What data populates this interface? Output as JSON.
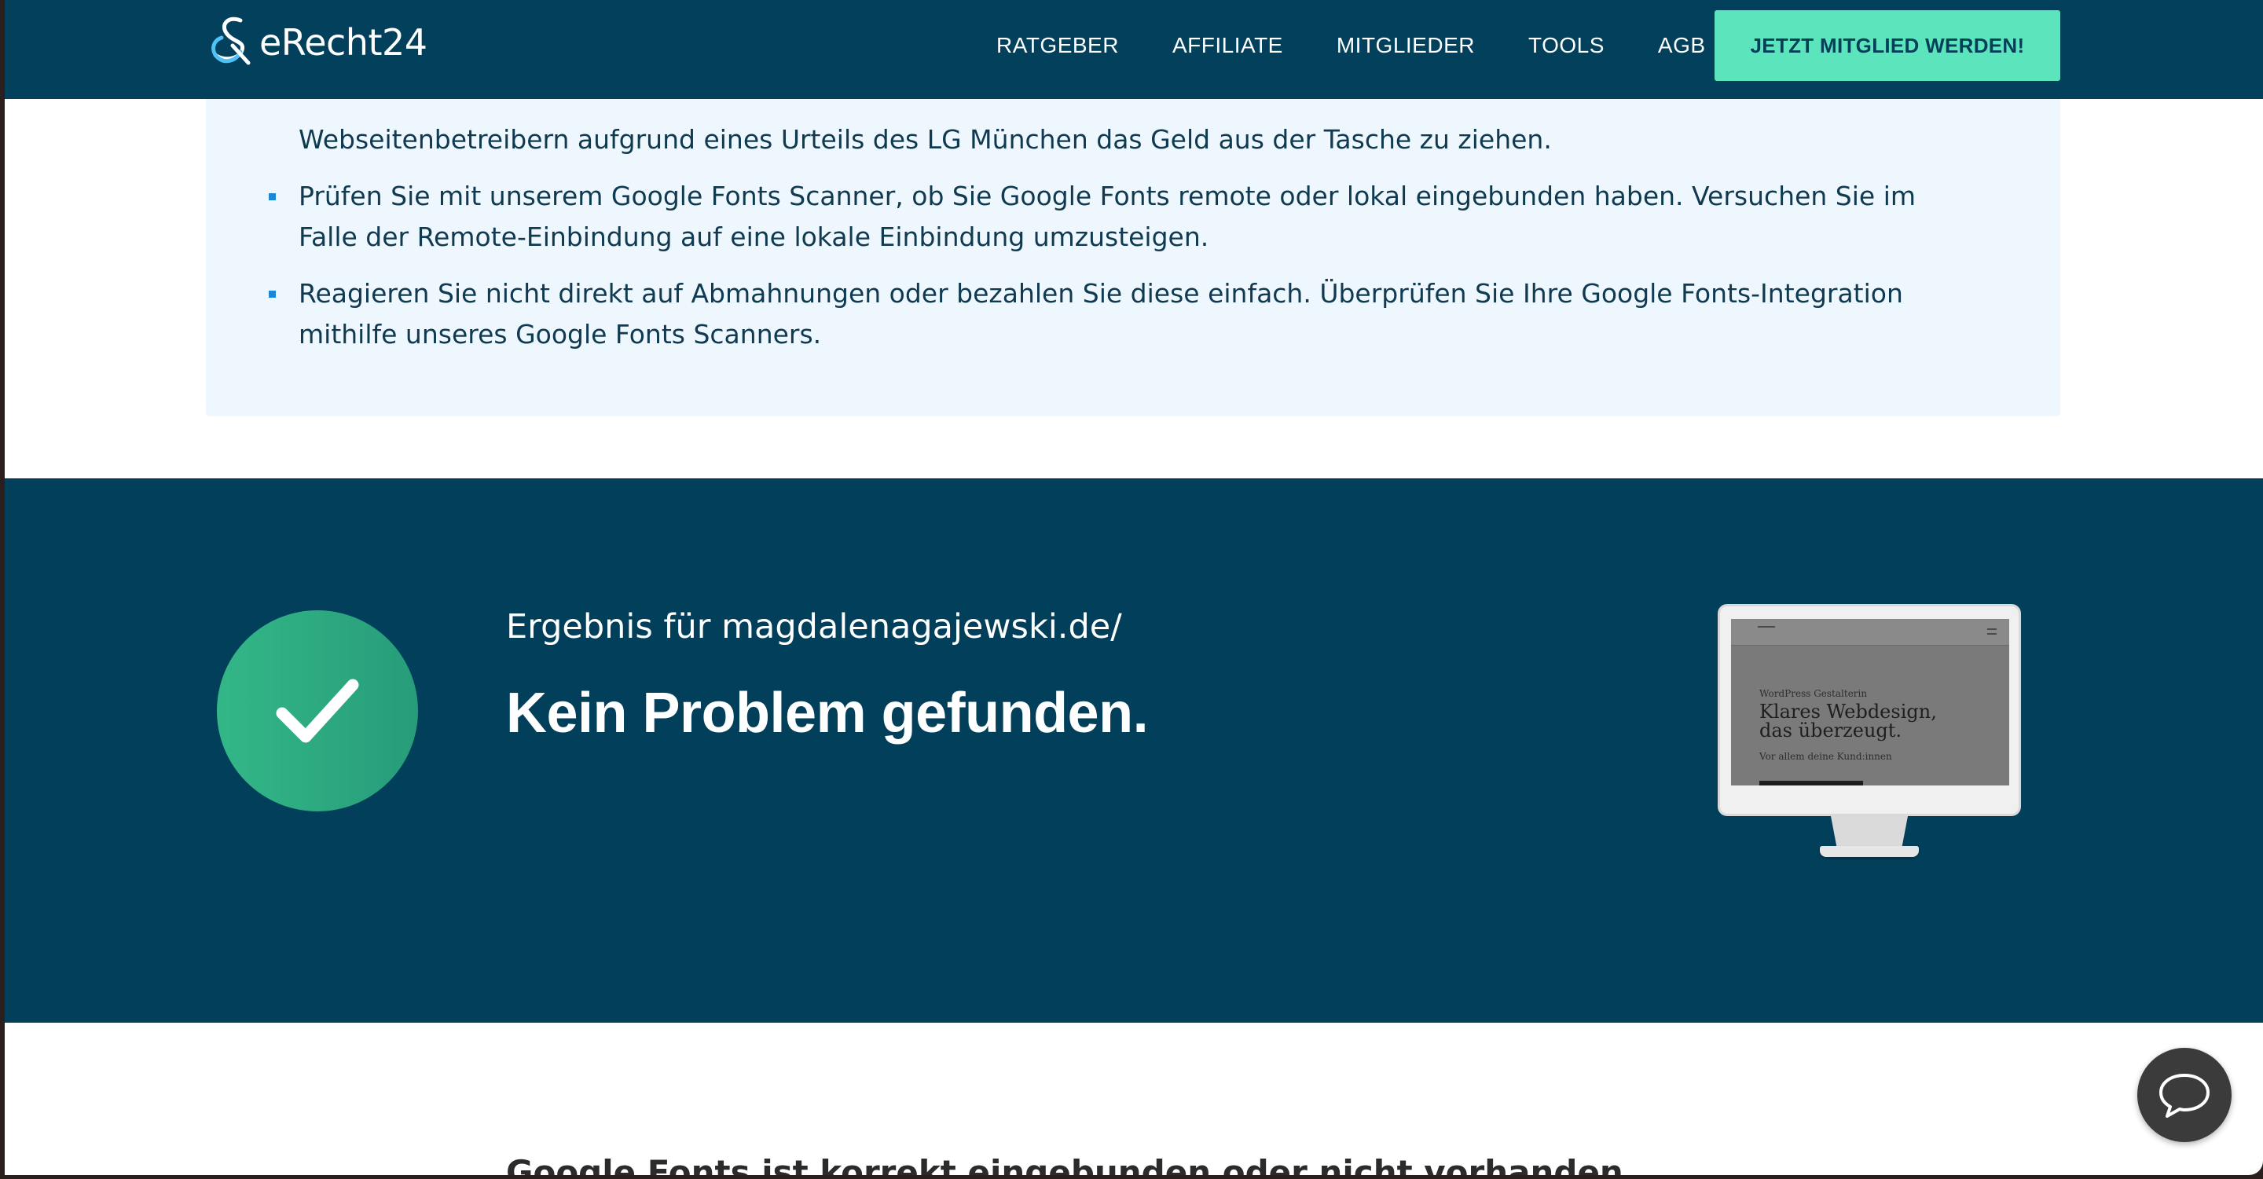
{
  "header": {
    "logo_text": "eRecht24",
    "nav": [
      {
        "label": "RATGEBER"
      },
      {
        "label": "AFFILIATE"
      },
      {
        "label": "MITGLIEDER"
      },
      {
        "label": "TOOLS"
      },
      {
        "label": "AGB"
      }
    ],
    "cta_label": "JETZT MITGLIED WERDEN!"
  },
  "info": {
    "items": [
      {
        "text": "Achtung: Es kursieren viele Abmahnungen von Privatpersonen und Abmahnkanzleien wegen Google Fonts. Sie versuchen Webseitenbetreibern aufgrund eines Urteils des LG München das Geld aus der Tasche zu ziehen.",
        "visible_text": "Webseitenbetreibern aufgrund eines Urteils des LG München das Geld aus der Tasche zu ziehen."
      },
      {
        "text": "Prüfen Sie mit unserem Google Fonts Scanner, ob Sie Google Fonts remote oder lokal eingebunden haben. Versuchen Sie im Falle der Remote-Einbindung auf eine lokale Einbindung umzusteigen."
      },
      {
        "text": "Reagieren Sie nicht direkt auf Abmahnungen oder bezahlen Sie diese einfach. Überprüfen Sie Ihre Google Fonts-Integration mithilfe unseres Google Fonts Scanners."
      }
    ]
  },
  "result": {
    "subtitle": "Ergebnis für magdalenagajewski.de/",
    "title": "Kein Problem gefunden.",
    "status_icon": "check-icon",
    "preview": {
      "kicker": "WordPress Gestalterin",
      "headline": "Klares Webdesign, das überzeugt.",
      "sub": "Vor allem deine Kund:innen"
    }
  },
  "next_section": {
    "heading": "Google Fonts ist korrekt eingebunden oder nicht vorhanden"
  },
  "chat": {
    "icon": "chat-bubble-icon"
  },
  "colors": {
    "header_bg": "#02405c",
    "cta_bg": "#5ce5bd",
    "info_bg": "#eef6fe",
    "result_bg": "#013f5b",
    "success_green": "#33b787"
  }
}
